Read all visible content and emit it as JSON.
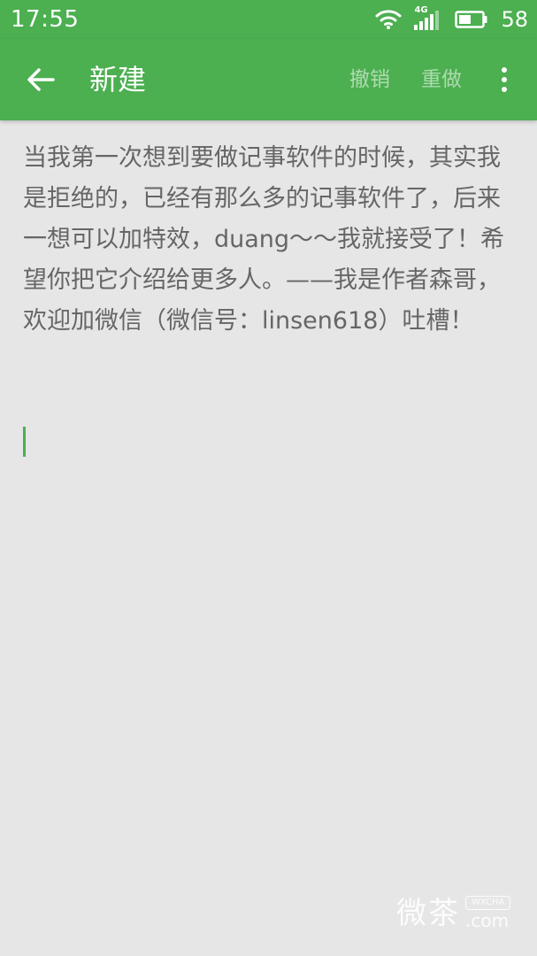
{
  "status_bar": {
    "time": "17:55",
    "network_type": "4G",
    "battery_level": "58",
    "icons": [
      "wifi-icon",
      "cellular-signal-icon",
      "battery-icon"
    ]
  },
  "toolbar": {
    "back_icon": "arrow-back-icon",
    "title": "新建",
    "undo_label": "撤销",
    "redo_label": "重做",
    "more_icon": "more-vertical-icon"
  },
  "editor": {
    "content": "当我第一次想到要做记事软件的时候，其实我是拒绝的，已经有那么多的记事软件了，后来一想可以加特效，duang～～我就接受了！希望你把它介绍给更多人。——我是作者森哥，欢迎加微信（微信号：linsen618）吐槽！"
  },
  "watermark": {
    "chinese": "微茶",
    "badge": "WXCHA",
    "domain": ".com"
  },
  "colors": {
    "primary": "#4caf50",
    "background": "#e6e6e6",
    "text": "#666666",
    "toolbar_action_disabled": "rgba(255,255,255,0.55)"
  }
}
